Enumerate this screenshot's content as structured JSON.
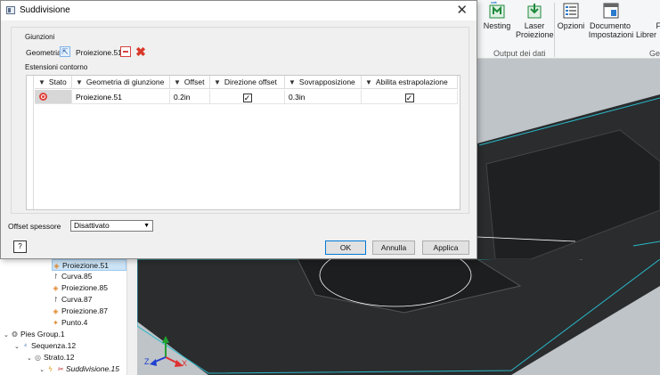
{
  "ribbon": {
    "buttons": [
      {
        "label": "Nesting",
        "icon": "nesting-icon"
      },
      {
        "label": "Laser Proiezione",
        "line1": "Laser",
        "line2": "Proiezione",
        "icon": "laser-projection-icon"
      },
      {
        "label": "Opzioni",
        "icon": "options-icon"
      },
      {
        "label": "Documento Impostazioni",
        "line1": "Documento",
        "line2": "Impostazioni",
        "icon": "document-settings-icon"
      },
      {
        "label": "Librerie",
        "line1": "F",
        "line2": "Librer",
        "icon": "libraries-icon"
      }
    ],
    "group_output": "Output dei dati",
    "group_gest": "Gest"
  },
  "dialog": {
    "title": "Suddivisione",
    "close_glyph": "✕",
    "giunzioni_label": "Giunzioni",
    "geometria_label": "Geometria",
    "geometria_value": "Proiezione.51",
    "estensioni_label": "Estensioni contorno",
    "table": {
      "headers": [
        "Stato",
        "Geometria di giunzione",
        "Offset",
        "Direzione offset",
        "Sovrapposizione",
        "Abilita estrapolazione"
      ],
      "rows": [
        {
          "stato": "error",
          "geometria": "Proiezione.51",
          "offset": "0.2in",
          "direzione": true,
          "sovrapposizione": "0.3in",
          "estrapolazione": true
        }
      ]
    },
    "offset_spessore_label": "Offset spessore",
    "offset_spessore_value": "Disattivato",
    "help_glyph": "?",
    "buttons": {
      "ok": "OK",
      "annulla": "Annulla",
      "applica": "Applica"
    }
  },
  "tree": {
    "items": [
      {
        "label": "Proiezione.51",
        "icon": "projection-icon",
        "selected": true
      },
      {
        "label": "Curva.85",
        "icon": "curve-icon"
      },
      {
        "label": "Proiezione.85",
        "icon": "projection-icon"
      },
      {
        "label": "Curva.87",
        "icon": "curve-icon"
      },
      {
        "label": "Proiezione.87",
        "icon": "projection-icon"
      },
      {
        "label": "Punto.4",
        "icon": "point-icon"
      },
      {
        "label": "Pies Group.1",
        "icon": "group-icon"
      },
      {
        "label": "Sequenza.12",
        "icon": "sequence-icon"
      },
      {
        "label": "Strato.12",
        "icon": "ply-icon"
      },
      {
        "label": "Suddivisione.15",
        "icon": "split-icon"
      }
    ]
  },
  "viewport": {
    "axis_x": "X",
    "axis_z": "Z"
  },
  "colors": {
    "accent": "#0078d7",
    "error": "#e0413a",
    "viewport_bg": "#bec4c8",
    "part": "#2a2c2e",
    "edge": "#2ab8c8"
  }
}
